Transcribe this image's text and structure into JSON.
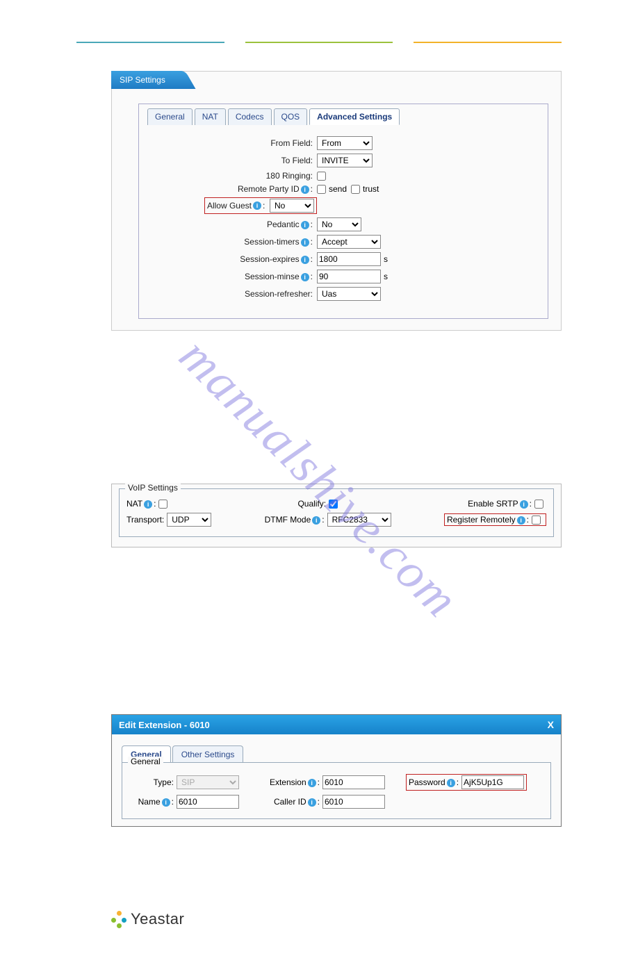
{
  "watermark": "manualshive.com",
  "sip_panel": {
    "title": "SIP Settings",
    "tabs": [
      "General",
      "NAT",
      "Codecs",
      "QOS",
      "Advanced Settings"
    ],
    "active_tab": "Advanced Settings",
    "fields": {
      "from_field": {
        "label": "From Field:",
        "value": "From"
      },
      "to_field": {
        "label": "To Field:",
        "value": "INVITE"
      },
      "ringing_180": {
        "label": "180 Ringing:",
        "checked": false
      },
      "remote_party_id": {
        "label": "Remote Party ID",
        "send_label": "send",
        "send": false,
        "trust_label": "trust",
        "trust": false
      },
      "allow_guest": {
        "label": "Allow Guest",
        "value": "No"
      },
      "pedantic": {
        "label": "Pedantic",
        "value": "No"
      },
      "session_timers": {
        "label": "Session-timers",
        "value": "Accept"
      },
      "session_expires": {
        "label": "Session-expires",
        "value": "1800",
        "unit": "s"
      },
      "session_minse": {
        "label": "Session-minse",
        "value": "90",
        "unit": "s"
      },
      "session_refresher": {
        "label": "Session-refresher:",
        "value": "Uas"
      }
    }
  },
  "voip_panel": {
    "legend": "VoIP Settings",
    "nat": {
      "label": "NAT",
      "checked": false
    },
    "qualify": {
      "label": "Qualify:",
      "checked": true
    },
    "enable_srtp": {
      "label": "Enable SRTP",
      "checked": false
    },
    "transport": {
      "label": "Transport:",
      "value": "UDP"
    },
    "dtmf_mode": {
      "label": "DTMF Mode",
      "value": "RFC2833"
    },
    "register_remotely": {
      "label": "Register Remotely",
      "checked": false
    }
  },
  "ext_panel": {
    "title": "Edit Extension - 6010",
    "tabs": [
      "General",
      "Other Settings"
    ],
    "active_tab": "General",
    "legend": "General",
    "type": {
      "label": "Type:",
      "value": "SIP"
    },
    "extension": {
      "label": "Extension",
      "value": "6010"
    },
    "password": {
      "label": "Password",
      "value": "AjK5Up1G"
    },
    "name": {
      "label": "Name",
      "value": "6010"
    },
    "caller_id": {
      "label": "Caller ID",
      "value": "6010"
    }
  },
  "footer": {
    "brand": "Yeastar"
  }
}
